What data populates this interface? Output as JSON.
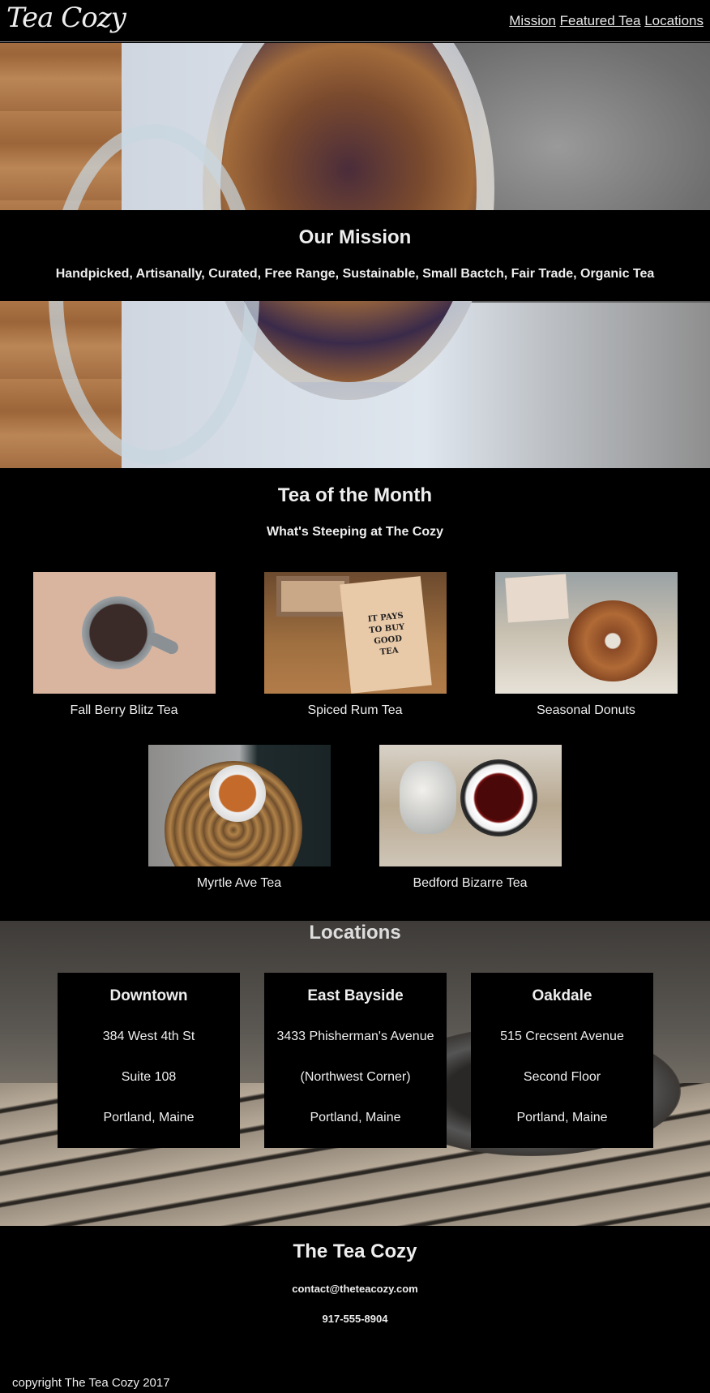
{
  "header": {
    "logo": "Tea Cozy",
    "nav": [
      "Mission",
      "Featured Tea",
      "Locations"
    ]
  },
  "mission": {
    "title": "Our Mission",
    "text": "Handpicked, Artisanally, Curated, Free Range, Sustainable, Small Bactch, Fair Trade, Organic Tea"
  },
  "tea_of_month": {
    "title": "Tea of the Month",
    "subtitle": "What's Steeping at The Cozy",
    "items": [
      {
        "label": "Fall Berry Blitz Tea"
      },
      {
        "label": "Spiced Rum Tea"
      },
      {
        "label": "Seasonal Donuts"
      },
      {
        "label": "Myrtle Ave Tea"
      },
      {
        "label": "Bedford Bizarre Tea"
      }
    ],
    "box_text": "IT PAYS TO BUY GOOD TEA"
  },
  "locations": {
    "title": "Locations",
    "cards": [
      {
        "name": "Downtown",
        "line1": "384 West 4th St",
        "line2": "Suite 108",
        "line3": "Portland, Maine"
      },
      {
        "name": "East Bayside",
        "line1": "3433 Phisherman's Avenue",
        "line2": "(Northwest Corner)",
        "line3": "Portland, Maine"
      },
      {
        "name": "Oakdale",
        "line1": "515 Crecsent Avenue",
        "line2": "Second Floor",
        "line3": "Portland, Maine"
      }
    ]
  },
  "footer": {
    "title": "The Tea Cozy",
    "email": "contact@theteacozy.com",
    "phone": "917-555-8904",
    "copyright": "copyright The Tea Cozy 2017"
  }
}
